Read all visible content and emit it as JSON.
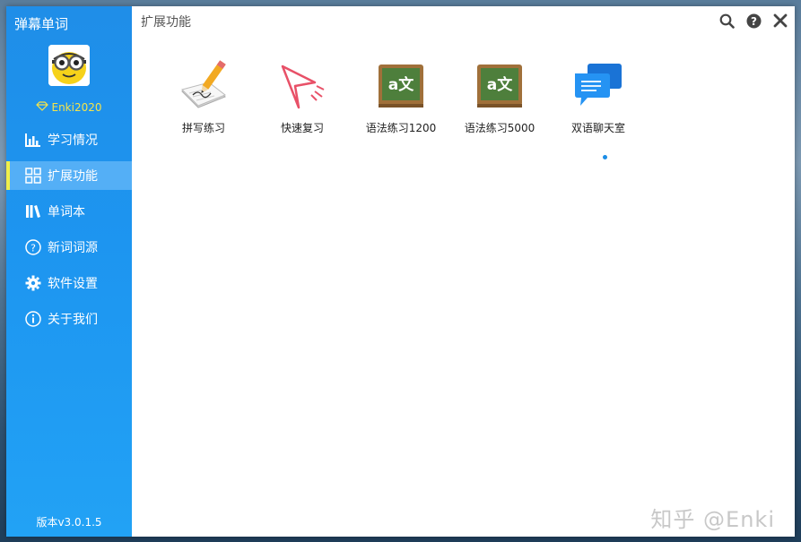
{
  "app": {
    "title": "弹幕单词",
    "username": "Enki2020",
    "version": "版本v3.0.1.5"
  },
  "sidebar": {
    "items": [
      {
        "label": "学习情况",
        "icon": "bar-chart-icon",
        "active": false
      },
      {
        "label": "扩展功能",
        "icon": "grid-icon",
        "active": true
      },
      {
        "label": "单词本",
        "icon": "books-icon",
        "active": false
      },
      {
        "label": "新词词源",
        "icon": "question-circle-icon",
        "active": false
      },
      {
        "label": "软件设置",
        "icon": "gear-icon",
        "active": false
      },
      {
        "label": "关于我们",
        "icon": "info-icon",
        "active": false
      }
    ]
  },
  "content": {
    "title": "扩展功能",
    "top_icons": [
      "search-icon",
      "help-icon",
      "close-icon"
    ]
  },
  "features": [
    {
      "label": "拼写练习",
      "icon": "spelling-pencil-icon"
    },
    {
      "label": "快速复习",
      "icon": "paper-plane-icon"
    },
    {
      "label": "语法练习1200",
      "icon": "chalkboard-icon",
      "board_text": "a文"
    },
    {
      "label": "语法练习5000",
      "icon": "chalkboard-icon",
      "board_text": "a文"
    },
    {
      "label": "双语聊天室",
      "icon": "chat-bubbles-icon"
    }
  ],
  "watermark": "知乎 @Enki",
  "colors": {
    "sidebar": "#1f8ee8",
    "active_item": "#54aff6",
    "active_marker": "#f0ef4a",
    "username": "#f5e44a"
  }
}
